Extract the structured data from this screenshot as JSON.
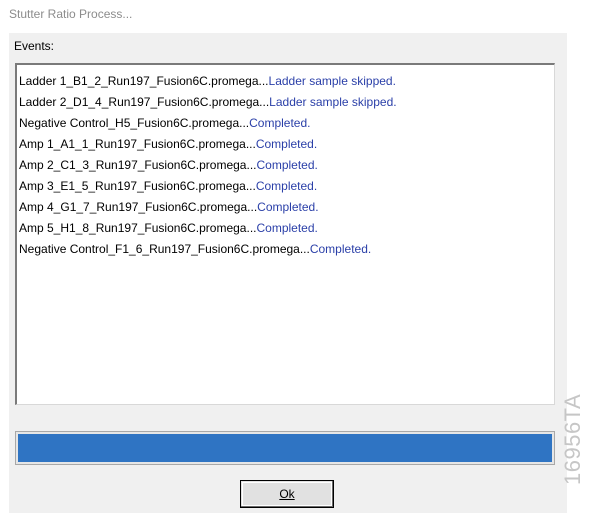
{
  "window": {
    "title": "Stutter Ratio Process..."
  },
  "events": {
    "label": "Events:",
    "items": [
      {
        "name": "Ladder 1_B1_2_Run197_Fusion6C.promega...",
        "status": "Ladder sample skipped."
      },
      {
        "name": "Ladder 2_D1_4_Run197_Fusion6C.promega...",
        "status": "Ladder sample skipped."
      },
      {
        "name": "Negative Control_H5_Fusion6C.promega...",
        "status": "Completed."
      },
      {
        "name": "Amp 1_A1_1_Run197_Fusion6C.promega...",
        "status": "Completed."
      },
      {
        "name": "Amp 2_C1_3_Run197_Fusion6C.promega...",
        "status": "Completed."
      },
      {
        "name": "Amp 3_E1_5_Run197_Fusion6C.promega...",
        "status": "Completed."
      },
      {
        "name": "Amp 4_G1_7_Run197_Fusion6C.promega...",
        "status": "Completed."
      },
      {
        "name": "Amp 5_H1_8_Run197_Fusion6C.promega...",
        "status": "Completed."
      },
      {
        "name": "Negative Control_F1_6_Run197_Fusion6C.promega...",
        "status": "Completed."
      }
    ]
  },
  "progress": {
    "percent": 100,
    "color": "#2f74c3"
  },
  "ok_button": {
    "label": "Ok"
  },
  "figure_code": "16956TA",
  "colors": {
    "status_text": "#2a3fa8",
    "dialog_background": "#f0f0f0"
  }
}
